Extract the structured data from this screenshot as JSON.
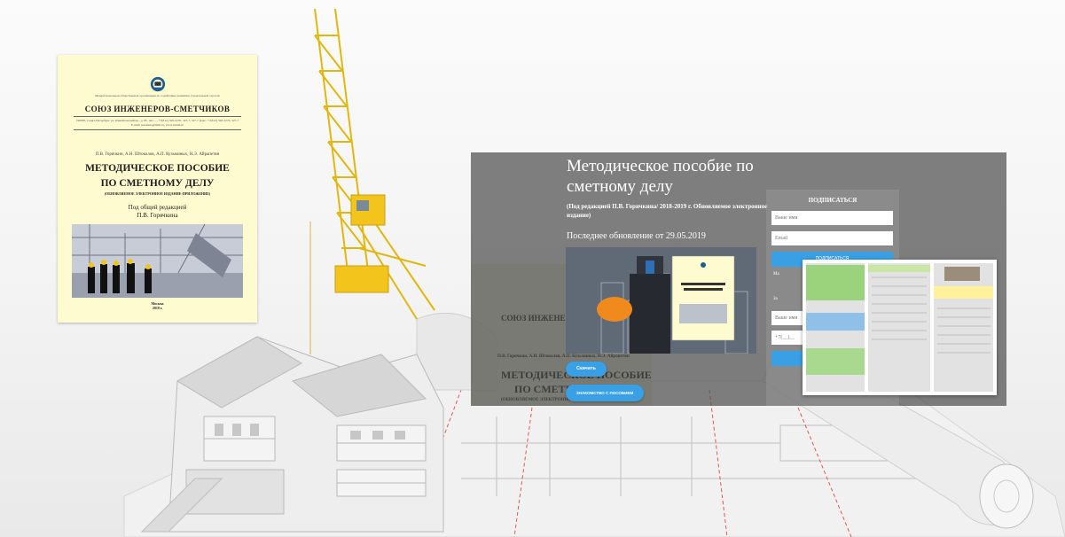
{
  "book": {
    "org_small": "Межрегиональная общественная организация по содействию развитию строительной отрасли",
    "org_title": "СОЮЗ ИНЖЕНЕРОВ-СМЕТЧИКОВ",
    "address": "190005, Санкт-Петербург, ул. Измайловский пр., д. 8б, лит. — +7(812) 326-2270, 327-7, 327-7 факс: +7(812) 326-2270, 327-7 E-mail: inzsmeta@mail.ru, www.inzsm.ru",
    "authors": "П.В. Горячкин, А.Н. Штоколов, А.П. Кузьминых, Н.Э. Айрапетян",
    "title_line1": "МЕТОДИЧЕСКОЕ ПОСОБИЕ",
    "title_line2": "ПО СМЕТНОМУ ДЕЛУ",
    "edition_note": "(ОБНОВЛЯЕМОЕ ЭЛЕКТРОННОЕ ИЗДАНИЕ-ПРИЛОЖЕНИЕ)",
    "editor_line1": "Под общей редакцией",
    "editor_line2": "П.В. Горячкина",
    "city": "Москва",
    "year": "2018 г."
  },
  "panel": {
    "title": "Методическое пособие по сметному делу",
    "subtitle": "(Под редакцией П.В. Горячкина/ 2018-2019 г. Обновляемое электронное издание)",
    "updated": "Последнее обновление от 29.05.2019",
    "download_label": "Скачать",
    "meet_label": "ЗНАКОМСТВО С ПОСОБИЕМ",
    "ghost_org": "СОЮЗ ИНЖЕНЕРОВ-СМЕТЧИКОВ",
    "ghost_title1": "МЕТОДИЧЕСКОЕ ПОСОБИЕ",
    "ghost_title2": "ПО СМЕТНОМУ ДЕЛУ",
    "ghost_note": "(ОБНОВЛЯЕМОЕ ЭЛЕКТРОННОЕ ИЗДАНИЕ-ПРИЛОЖЕНИЕ)",
    "ghost_authors": "П.В. Горячкин, А.Н. Штоколов, А.П. Кузьминых, Н.Э. Айрапетян"
  },
  "form": {
    "title": "ПОДПИСАТЬСЯ",
    "name_placeholder": "Ваше имя",
    "email_placeholder": "Email",
    "subscribe_label": "ПОДПИСАТЬСЯ",
    "small1": "Ма",
    "small2": "За",
    "name2_placeholder": "Ваше имя",
    "phone_placeholder": "+7(__)__"
  },
  "colors": {
    "accent": "#3aa0e6",
    "book_bg": "#fffbd1",
    "crane": "#f2c41c"
  }
}
